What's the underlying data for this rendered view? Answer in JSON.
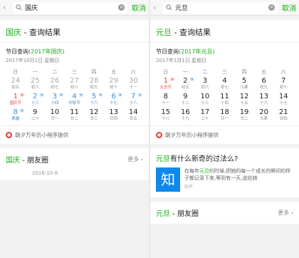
{
  "left": {
    "query": "国庆",
    "cancel": "取消",
    "result_keyword": "国庆",
    "result_suffix": " - 查询结果",
    "holiday_label": "节日查询",
    "holiday_tag": "(2017年国庆)",
    "date_line": "2017年10月1日    星期日",
    "weekdays": [
      "日",
      "一",
      "二",
      "三",
      "四",
      "五",
      "六"
    ],
    "days": [
      {
        "n": "24",
        "s": "初五",
        "c": "gray"
      },
      {
        "n": "25",
        "s": "初六",
        "c": "gray"
      },
      {
        "n": "26",
        "s": "初七",
        "c": "gray"
      },
      {
        "n": "27",
        "s": "初八",
        "c": "gray"
      },
      {
        "n": "28",
        "s": "初九",
        "c": "gray"
      },
      {
        "n": "29",
        "s": "初十",
        "c": "gray"
      },
      {
        "n": "30",
        "s": "十一",
        "c": "gray"
      },
      {
        "n": "1",
        "s": "国庆节",
        "c": "red",
        "b": "休"
      },
      {
        "n": "2",
        "s": "十三",
        "c": "blue",
        "b": "休"
      },
      {
        "n": "3",
        "s": "十四",
        "c": "blue",
        "b": "休"
      },
      {
        "n": "4",
        "s": "中秋节",
        "c": "blue",
        "b": "休"
      },
      {
        "n": "5",
        "s": "十六",
        "c": "blue",
        "b": "休"
      },
      {
        "n": "6",
        "s": "十七",
        "c": "blue",
        "b": "休"
      },
      {
        "n": "7",
        "s": "十八",
        "c": "blue",
        "b": "休"
      },
      {
        "n": "8",
        "s": "寒露",
        "c": "blue",
        "b": "休"
      },
      {
        "n": "9",
        "s": "二十",
        "c": ""
      },
      {
        "n": "10",
        "s": "廿一",
        "c": ""
      },
      {
        "n": "11",
        "s": "廿二",
        "c": ""
      },
      {
        "n": "12",
        "s": "廿三",
        "c": ""
      },
      {
        "n": "13",
        "s": "廿四",
        "c": ""
      },
      {
        "n": "14",
        "s": "廿五",
        "c": ""
      }
    ],
    "source": "朝夕万年历小程序提供",
    "moments_keyword": "国庆",
    "moments_suffix": " - 朋友圈",
    "more": "更多",
    "moments_date": "2016-10-8"
  },
  "right": {
    "query": "元旦",
    "cancel": "取消",
    "result_keyword": "元旦",
    "result_suffix": " - 查询结果",
    "holiday_label": "节日查询",
    "holiday_tag": "(2017年元旦)",
    "date_line": "2017年1月1日    星期日",
    "weekdays": [
      "日",
      "一",
      "二",
      "三",
      "四",
      "五",
      "六"
    ],
    "days": [
      {
        "n": "1",
        "s": "元旦节",
        "c": "red",
        "b": "休"
      },
      {
        "n": "2",
        "s": "初五",
        "c": "",
        "b": "休"
      },
      {
        "n": "3",
        "s": "初六",
        "c": ""
      },
      {
        "n": "4",
        "s": "初七",
        "c": ""
      },
      {
        "n": "5",
        "s": "小寒",
        "c": ""
      },
      {
        "n": "6",
        "s": "初九",
        "c": ""
      },
      {
        "n": "7",
        "s": "初十",
        "c": ""
      },
      {
        "n": "8",
        "s": "十一",
        "c": ""
      },
      {
        "n": "9",
        "s": "十二",
        "c": ""
      },
      {
        "n": "10",
        "s": "十三",
        "c": ""
      },
      {
        "n": "11",
        "s": "十四",
        "c": ""
      },
      {
        "n": "12",
        "s": "十五",
        "c": ""
      },
      {
        "n": "13",
        "s": "十六",
        "c": ""
      },
      {
        "n": "14",
        "s": "十七",
        "c": ""
      },
      {
        "n": "15",
        "s": "十八",
        "c": ""
      },
      {
        "n": "16",
        "s": "十九",
        "c": ""
      },
      {
        "n": "17",
        "s": "二十",
        "c": ""
      },
      {
        "n": "18",
        "s": "廿一",
        "c": ""
      },
      {
        "n": "19",
        "s": "廿二",
        "c": ""
      },
      {
        "n": "20",
        "s": "大寒",
        "c": ""
      },
      {
        "n": "21",
        "s": "廿四",
        "c": ""
      }
    ],
    "source": "朝夕万年历小程序提供",
    "zhihu_keyword": "元旦",
    "zhihu_title_suffix": "有什么新奇的过法么?",
    "zhihu_logo": "知",
    "zhihu_pre": "在每年",
    "zhihu_hl": "元旦",
    "zhihu_post": "的时候,把她的每一个成长的瞬间的样子都记录下来,等到有一天,送给她",
    "zhihu_source": "知乎",
    "moments_keyword": "元旦",
    "moments_suffix": " - 朋友圈",
    "more": "更多"
  },
  "colors": {
    "accent": "#1aad19",
    "holiday_red": "#e64340",
    "leave_blue": "#3b8fd6",
    "zhihu_blue": "#0f88eb"
  }
}
